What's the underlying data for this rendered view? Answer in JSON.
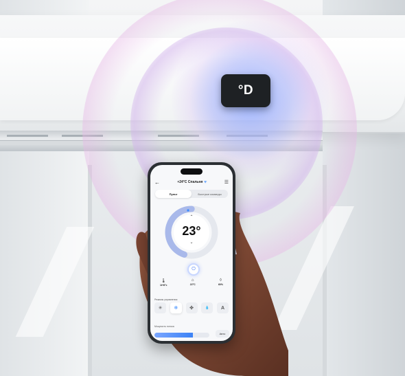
{
  "device_badge": {
    "label": "°D"
  },
  "app": {
    "header": {
      "back_icon": "arrow-left-icon",
      "title": "+24°C Спальня",
      "menu_icon": "sliders-icon"
    },
    "tabs": [
      {
        "label": "Пульт",
        "active": true
      },
      {
        "label": "Быстрые команды",
        "active": false
      }
    ],
    "thermostat": {
      "value": "23°",
      "level": 0.45,
      "accent": "#3a8bff"
    },
    "stats": [
      {
        "icon": "thermometer-icon",
        "value": "1t+8°c"
      },
      {
        "icon": "home-temp-icon",
        "value": "22°C"
      },
      {
        "icon": "droplet-icon",
        "value": "60%"
      }
    ],
    "modes_label": "Режимы управления",
    "modes": [
      {
        "icon": "sun-icon",
        "glyph": "✳",
        "active": false
      },
      {
        "icon": "snowflake-icon",
        "glyph": "❄",
        "active": true
      },
      {
        "icon": "fan-icon",
        "glyph": "✤",
        "active": false
      },
      {
        "icon": "drop-icon",
        "glyph": "💧",
        "active": false
      },
      {
        "icon": "auto-icon",
        "glyph": "A",
        "active": false
      }
    ],
    "flow_label": "Мощность потока",
    "flow_level": 0.7,
    "auto_label": "Авто"
  }
}
